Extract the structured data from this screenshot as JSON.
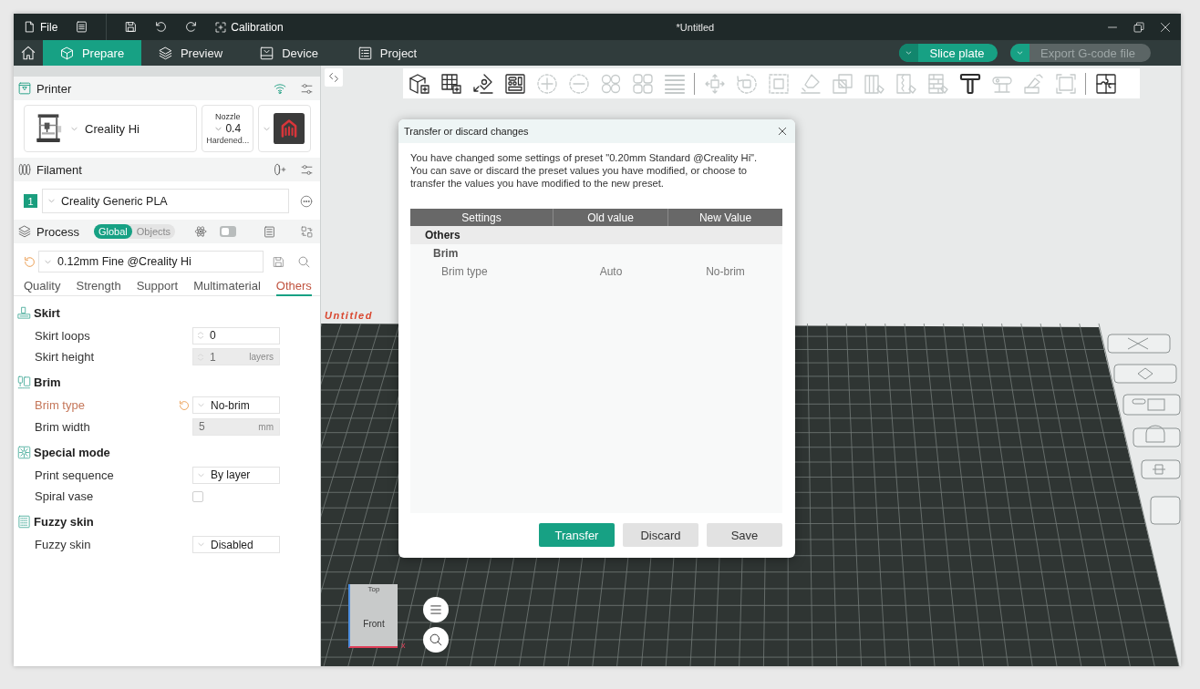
{
  "title_bar": {
    "file_label": "File",
    "calibration_label": "Calibration",
    "title": "*Untitled"
  },
  "main_tabs": [
    {
      "label": "Prepare",
      "selected": true
    },
    {
      "label": "Preview",
      "selected": false
    },
    {
      "label": "Device",
      "selected": false
    },
    {
      "label": "Project",
      "selected": false
    }
  ],
  "action_buttons": [
    {
      "label": "Slice plate",
      "disabled": false
    },
    {
      "label": "Export G-code file",
      "disabled": true
    }
  ],
  "sidebar": {
    "printer": {
      "title": "Printer",
      "name": "Creality Hi",
      "nozzle_label": "Nozzle",
      "nozzle_size": "0.4",
      "nozzle_type": "Hardened..."
    },
    "filament": {
      "title": "Filament",
      "slots": [
        {
          "number": "1",
          "color": "#1a9e7e",
          "name": "Creality Generic PLA"
        }
      ]
    },
    "process": {
      "title": "Process",
      "scope": [
        {
          "label": "Global",
          "selected": true
        },
        {
          "label": "Objects",
          "selected": false
        }
      ],
      "advanced_on": false,
      "preset": "0.12mm Fine @Creality Hi",
      "preset_modified": true,
      "tabs": [
        {
          "label": "Quality",
          "selected": false
        },
        {
          "label": "Strength",
          "selected": false
        },
        {
          "label": "Support",
          "selected": false
        },
        {
          "label": "Multimaterial",
          "selected": false
        },
        {
          "label": "Others",
          "selected": true
        }
      ]
    },
    "groups": [
      {
        "title": "Skirt",
        "settings": [
          {
            "label": "Skirt loops",
            "kind": "spin",
            "value": "0",
            "disabled": false,
            "modified": false
          },
          {
            "label": "Skirt height",
            "kind": "spin",
            "value": "1",
            "unit": "layers",
            "disabled": true,
            "modified": false
          }
        ]
      },
      {
        "title": "Brim",
        "settings": [
          {
            "label": "Brim type",
            "kind": "dropdown",
            "value": "No-brim",
            "disabled": false,
            "modified": true
          },
          {
            "label": "Brim width",
            "kind": "number",
            "value": "5",
            "unit": "mm",
            "disabled": true,
            "modified": false
          }
        ]
      },
      {
        "title": "Special mode",
        "settings": [
          {
            "label": "Print sequence",
            "kind": "dropdown",
            "value": "By layer",
            "disabled": false,
            "modified": false
          },
          {
            "label": "Spiral vase",
            "kind": "checkbox",
            "checked": false,
            "disabled": false,
            "modified": false
          }
        ]
      },
      {
        "title": "Fuzzy skin",
        "settings": [
          {
            "label": "Fuzzy skin",
            "kind": "dropdown",
            "value": "Disabled",
            "disabled": false,
            "modified": false
          }
        ]
      }
    ]
  },
  "toolbar": [
    [
      {
        "disabled": false
      },
      {
        "disabled": false
      },
      {
        "disabled": false
      },
      {
        "disabled": false
      },
      {
        "disabled": true
      },
      {
        "disabled": true
      },
      {
        "disabled": true
      },
      {
        "disabled": true
      },
      {
        "disabled": true
      }
    ],
    [
      {
        "disabled": true
      },
      {
        "disabled": true
      },
      {
        "disabled": true
      },
      {
        "disabled": true
      },
      {
        "disabled": true
      },
      {
        "disabled": true
      },
      {
        "disabled": true
      },
      {
        "disabled": true
      },
      {
        "disabled": false
      },
      {
        "disabled": true
      },
      {
        "disabled": true
      },
      {
        "disabled": true
      }
    ],
    [
      {
        "disabled": false
      }
    ]
  ],
  "canvas": {
    "plate_name": "Untitled",
    "view_cube": {
      "top": "Top",
      "front": "Front",
      "axis": "x"
    }
  },
  "dialog": {
    "title": "Transfer or discard changes",
    "message": "You have changed some settings of preset \"0.20mm Standard @Creality Hi\".\nYou can save or discard the preset values you have modified, or choose to transfer the values you have modified to the new preset.",
    "columns": [
      "Settings",
      "Old value",
      "New Value"
    ],
    "groups": [
      {
        "label": "Others",
        "children": [
          {
            "label": "Brim",
            "children": [
              {
                "setting": "Brim type",
                "old_value": "Auto",
                "new_value": "No-brim"
              }
            ]
          }
        ]
      }
    ],
    "buttons": [
      {
        "label": "Transfer",
        "kind": "primary"
      },
      {
        "label": "Discard",
        "kind": "secondary"
      },
      {
        "label": "Save",
        "kind": "secondary"
      }
    ]
  }
}
